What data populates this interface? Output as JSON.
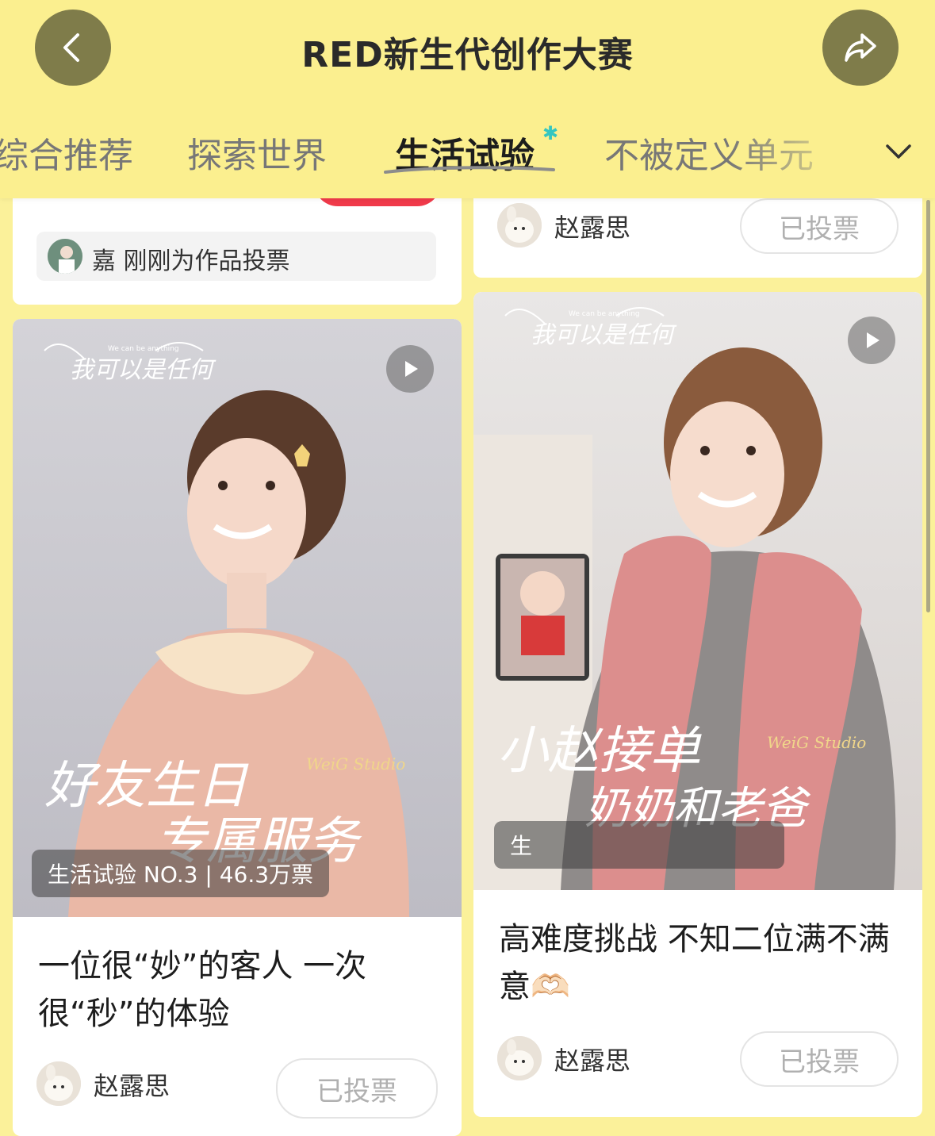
{
  "header": {
    "title": "RED新生代创作大赛",
    "back_icon": "chevron-left-icon",
    "share_icon": "share-arrow-icon"
  },
  "tabs": [
    {
      "label": "综合推荐",
      "active": false
    },
    {
      "label": "探索世界",
      "active": false
    },
    {
      "label": "生活试验",
      "active": true
    },
    {
      "label": "不被定义单元",
      "active": false
    }
  ],
  "tabs_more_icon": "chevron-down-icon",
  "left_column": {
    "top_card": {
      "notice": "嘉  刚刚为作品投票"
    },
    "card": {
      "overlay_logo": "我可以是任何",
      "overlay_sub": "We can be anything",
      "overlay_caption_line1": "好友生日",
      "overlay_caption_line2": "专属服务",
      "overlay_studio": "WeiG Studio",
      "badge": "生活试验 NO.3 | 46.3万票",
      "title": "一位很“妙”的客人 一次很“秒”的体验",
      "author": "赵露思",
      "vote_label": "已投票"
    }
  },
  "right_column": {
    "top_card": {
      "author": "赵露思",
      "vote_label": "已投票"
    },
    "card": {
      "overlay_logo": "我可以是任何",
      "overlay_sub": "We can be anything",
      "overlay_caption_line1": "小赵接单",
      "overlay_caption_line2": "奶奶和老爸",
      "overlay_studio": "WeiG Studio",
      "badge": "生",
      "title": "高难度挑战 不知二位满不满意🫶🏻",
      "author": "赵露思",
      "vote_label": "已投票"
    }
  },
  "colors": {
    "header_bg": "#fbef8f",
    "page_bg": "#fbf19a",
    "button_dark": "#7f7c4a",
    "vote_text": "#b0b0b0"
  }
}
